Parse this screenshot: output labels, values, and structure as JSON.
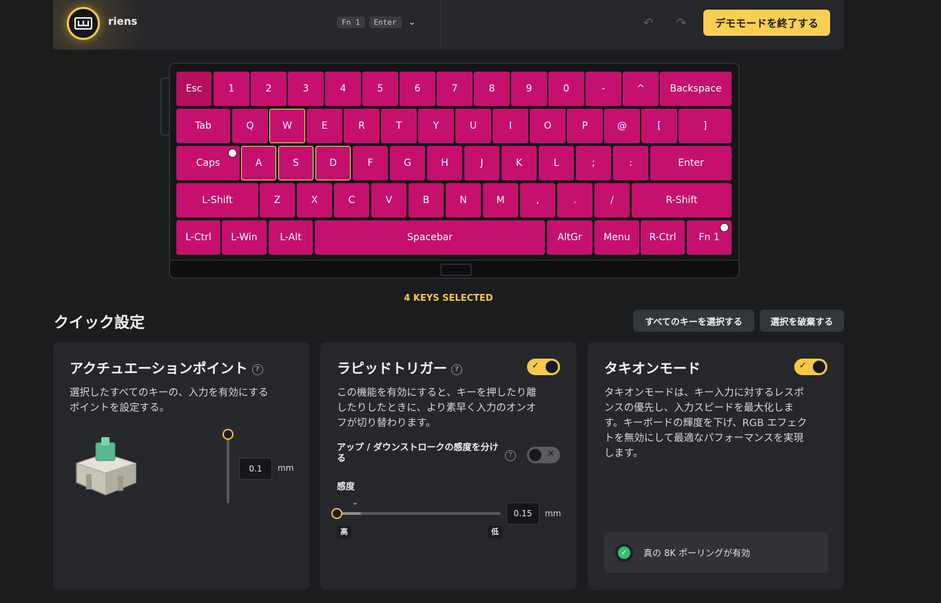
{
  "header": {
    "device_name": "riens",
    "fn_chip": "Fn 1",
    "key_chip": "Enter",
    "exit_demo_label": "デモモードを終了する"
  },
  "keyboard": {
    "rows": [
      [
        "Esc",
        "1",
        "2",
        "3",
        "4",
        "5",
        "6",
        "7",
        "8",
        "9",
        "0",
        "-",
        "^",
        "Backspace"
      ],
      [
        "Tab",
        "Q",
        "W",
        "E",
        "R",
        "T",
        "Y",
        "U",
        "I",
        "O",
        "P",
        "@",
        "[",
        "]"
      ],
      [
        "Caps",
        "A",
        "S",
        "D",
        "F",
        "G",
        "H",
        "J",
        "K",
        "L",
        ";",
        ":",
        "Enter"
      ],
      [
        "L-Shift",
        "Z",
        "X",
        "C",
        "V",
        "B",
        "N",
        "M",
        ",",
        ".",
        "/",
        "R-Shift"
      ],
      [
        "L-Ctrl",
        "L-Win",
        "L-Alt",
        "Spacebar",
        "AltGr",
        "Menu",
        "R-Ctrl",
        "Fn 1"
      ]
    ],
    "selected_keys": [
      "W",
      "A",
      "S",
      "D"
    ],
    "key_color": "#c5106d"
  },
  "selection": {
    "status": "4 KEYS SELECTED"
  },
  "quick_settings": {
    "title": "クイック設定",
    "select_all_label": "すべてのキーを選択する",
    "deselect_label": "選択を破棄する"
  },
  "actuation": {
    "title": "アクチュエーションポイント",
    "desc_line1": "選択したすべてのキーの、入力を有効にする",
    "desc_line2": "ポイントを設定する。",
    "value": "0.1",
    "unit": "mm",
    "level": 0.0
  },
  "rapid_trigger": {
    "title": "ラピッドトリガー",
    "enabled": true,
    "desc_line1": "この機能を有効にすると、キーを押したり離",
    "desc_line2": "したりしたときに、より素早く入力のオンオ",
    "desc_line3": "フが切り替わります。",
    "split_label": "アップ / ダウンストロークの感度を分ける",
    "split_enabled": false,
    "sensitivity_label": "感度",
    "sensitivity_value": "0.15",
    "unit": "mm",
    "high_label": "高",
    "low_label": "低",
    "level": 0.0
  },
  "tachyon": {
    "title": "タキオンモード",
    "enabled": true,
    "desc_line1": "タキオンモードは、キー入力に対するレスポ",
    "desc_line2": "ンスの優先し、入力スピードを最大化しま",
    "desc_line3": "す。キーボードの輝度を下げ、RGB エフェク",
    "desc_line4": "トを無効にして最適なパフォーマンスを実現",
    "desc_line5": "します。",
    "polling_text": "真の 8K ポーリングが有効"
  },
  "colors": {
    "accent": "#fcce52",
    "key": "#c5106d",
    "success": "#2ec26a"
  },
  "icons": [
    "wooting-logo-icon",
    "chevron-down-icon",
    "undo-icon",
    "redo-icon",
    "help-icon",
    "check-icon",
    "close-icon",
    "check-circle-icon"
  ]
}
